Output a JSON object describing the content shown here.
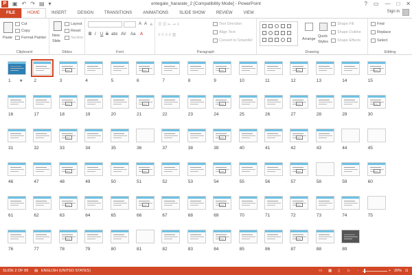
{
  "titlebar": {
    "app_logo": "P",
    "qat_items": [
      "save-icon",
      "undo-icon",
      "redo-icon",
      "start-from-beginning-icon",
      "customize-icon"
    ],
    "title": "entegale_hararate_2 [Compatibility Mode] - PowerPoint",
    "controls": {
      "help": "?",
      "restore": "▭",
      "minimize": "—",
      "maximize": "□",
      "close": "✕"
    }
  },
  "tabs": [
    {
      "label": "FILE"
    },
    {
      "label": "HOME"
    },
    {
      "label": "INSERT"
    },
    {
      "label": "DESIGN"
    },
    {
      "label": "TRANSITIONS"
    },
    {
      "label": "ANIMATIONS"
    },
    {
      "label": "SLIDE SHOW"
    },
    {
      "label": "REVIEW"
    },
    {
      "label": "VIEW"
    }
  ],
  "active_tab": "HOME",
  "signin": "Sign in",
  "ribbon": {
    "clipboard": {
      "paste": "Paste",
      "cut": "Cut",
      "copy": "Copy",
      "format_painter": "Format Painter",
      "label": "Clipboard"
    },
    "slides": {
      "new_slide": "New",
      "new_slide_2": "Slide",
      "layout": "Layout",
      "reset": "Reset",
      "section": "Section",
      "label": "Slides"
    },
    "font": {
      "label": "Font",
      "bold": "B",
      "italic": "I",
      "underline": "U",
      "strike": "S",
      "shadow": "abc",
      "spacing": "AV",
      "case": "Aa",
      "color": "A"
    },
    "paragraph": {
      "text_direction": "Text Direction",
      "align_text": "Align Text",
      "convert": "Convert to SmartArt",
      "label": "Paragraph"
    },
    "drawing": {
      "arrange": "Arrange",
      "quick_styles": "Quick",
      "quick_styles_2": "Styles",
      "shape_fill": "Shape Fill",
      "shape_outline": "Shape Outline",
      "shape_effects": "Shape Effects",
      "label": "Drawing"
    },
    "editing": {
      "find": "Find",
      "replace": "Replace",
      "select": "Select",
      "label": "Editing"
    }
  },
  "slides": {
    "total": 89,
    "selected": 2,
    "numbers": [
      "1",
      "2",
      "3",
      "4",
      "5",
      "6",
      "7",
      "8",
      "9",
      "10",
      "11",
      "12",
      "13",
      "14",
      "15",
      "16",
      "17",
      "18",
      "19",
      "20",
      "21",
      "22",
      "23",
      "24",
      "25",
      "26",
      "27",
      "28",
      "29",
      "30",
      "31",
      "32",
      "33",
      "34",
      "35",
      "36",
      "37",
      "38",
      "39",
      "40",
      "41",
      "42",
      "43",
      "44",
      "45",
      "46",
      "47",
      "48",
      "49",
      "50",
      "51",
      "52",
      "53",
      "54",
      "55",
      "56",
      "57",
      "58",
      "59",
      "60",
      "61",
      "62",
      "63",
      "64",
      "65",
      "66",
      "67",
      "68",
      "69",
      "70",
      "71",
      "72",
      "73",
      "74",
      "75",
      "76",
      "77",
      "78",
      "79",
      "80",
      "81",
      "82",
      "83",
      "84",
      "85",
      "86",
      "87",
      "88",
      "89"
    ],
    "star_on_slide": 1,
    "star_glyph": "★"
  },
  "status": {
    "slide_info": "SLIDE 2 OF 89",
    "language": "ENGLISH (UNITED STATES)",
    "zoom": "20%",
    "zoom_minus": "-",
    "zoom_plus": "+"
  },
  "colors": {
    "accent": "#d24726",
    "slide_bar": "#6ec1e4"
  }
}
